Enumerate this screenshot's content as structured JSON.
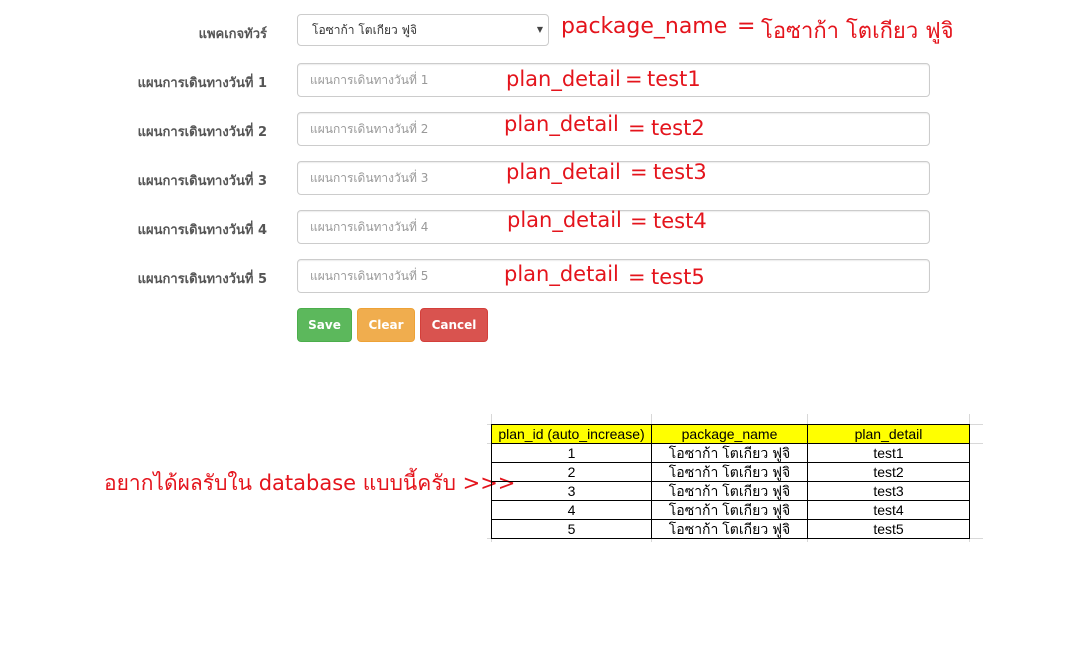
{
  "form": {
    "package_label": "แพคเกจทัวร์",
    "package_selected": "โอซาก้า โตเกียว ฟูจิ",
    "plan_fields": [
      {
        "label": "แผนการเดินทางวันที่ 1",
        "placeholder": "แผนการเดินทางวันที่ 1"
      },
      {
        "label": "แผนการเดินทางวันที่ 2",
        "placeholder": "แผนการเดินทางวันที่ 2"
      },
      {
        "label": "แผนการเดินทางวันที่ 3",
        "placeholder": "แผนการเดินทางวันที่ 3"
      },
      {
        "label": "แผนการเดินทางวันที่ 4",
        "placeholder": "แผนการเดินทางวันที่ 4"
      },
      {
        "label": "แผนการเดินทางวันที่ 5",
        "placeholder": "แผนการเดินทางวันที่ 5"
      }
    ],
    "buttons": {
      "save": "Save",
      "clear": "Clear",
      "cancel": "Cancel"
    }
  },
  "annotations": {
    "package": {
      "field": "package_name",
      "eq": "=",
      "value": "โอซาก้า โตเกียว ฟูจิ"
    },
    "plans": [
      {
        "field": "plan_detail",
        "eq": "=",
        "value": "test1"
      },
      {
        "field": "plan_detail",
        "eq": "=",
        "value": "test2"
      },
      {
        "field": "plan_detail",
        "eq": "=",
        "value": "test3"
      },
      {
        "field": "plan_detail",
        "eq": "=",
        "value": "test4"
      },
      {
        "field": "plan_detail",
        "eq": "=",
        "value": "test5"
      }
    ],
    "wish_text": "อยากได้ผลรับใน database แบบนี้ครับ >>>"
  },
  "db_table": {
    "headers": [
      "plan_id (auto_increase)",
      "package_name",
      "plan_detail"
    ],
    "rows": [
      [
        "1",
        "โอซาก้า โตเกียว ฟูจิ",
        "test1"
      ],
      [
        "2",
        "โอซาก้า โตเกียว ฟูจิ",
        "test2"
      ],
      [
        "3",
        "โอซาก้า โตเกียว ฟูจิ",
        "test3"
      ],
      [
        "4",
        "โอซาก้า โตเกียว ฟูจิ",
        "test4"
      ],
      [
        "5",
        "โอซาก้า โตเกียว ฟูจิ",
        "test5"
      ]
    ]
  },
  "colors": {
    "annotation": "#e4141c",
    "save": "#5cb85c",
    "clear": "#f0ad4e",
    "cancel": "#d9534f",
    "header_fill": "#ffff00"
  }
}
